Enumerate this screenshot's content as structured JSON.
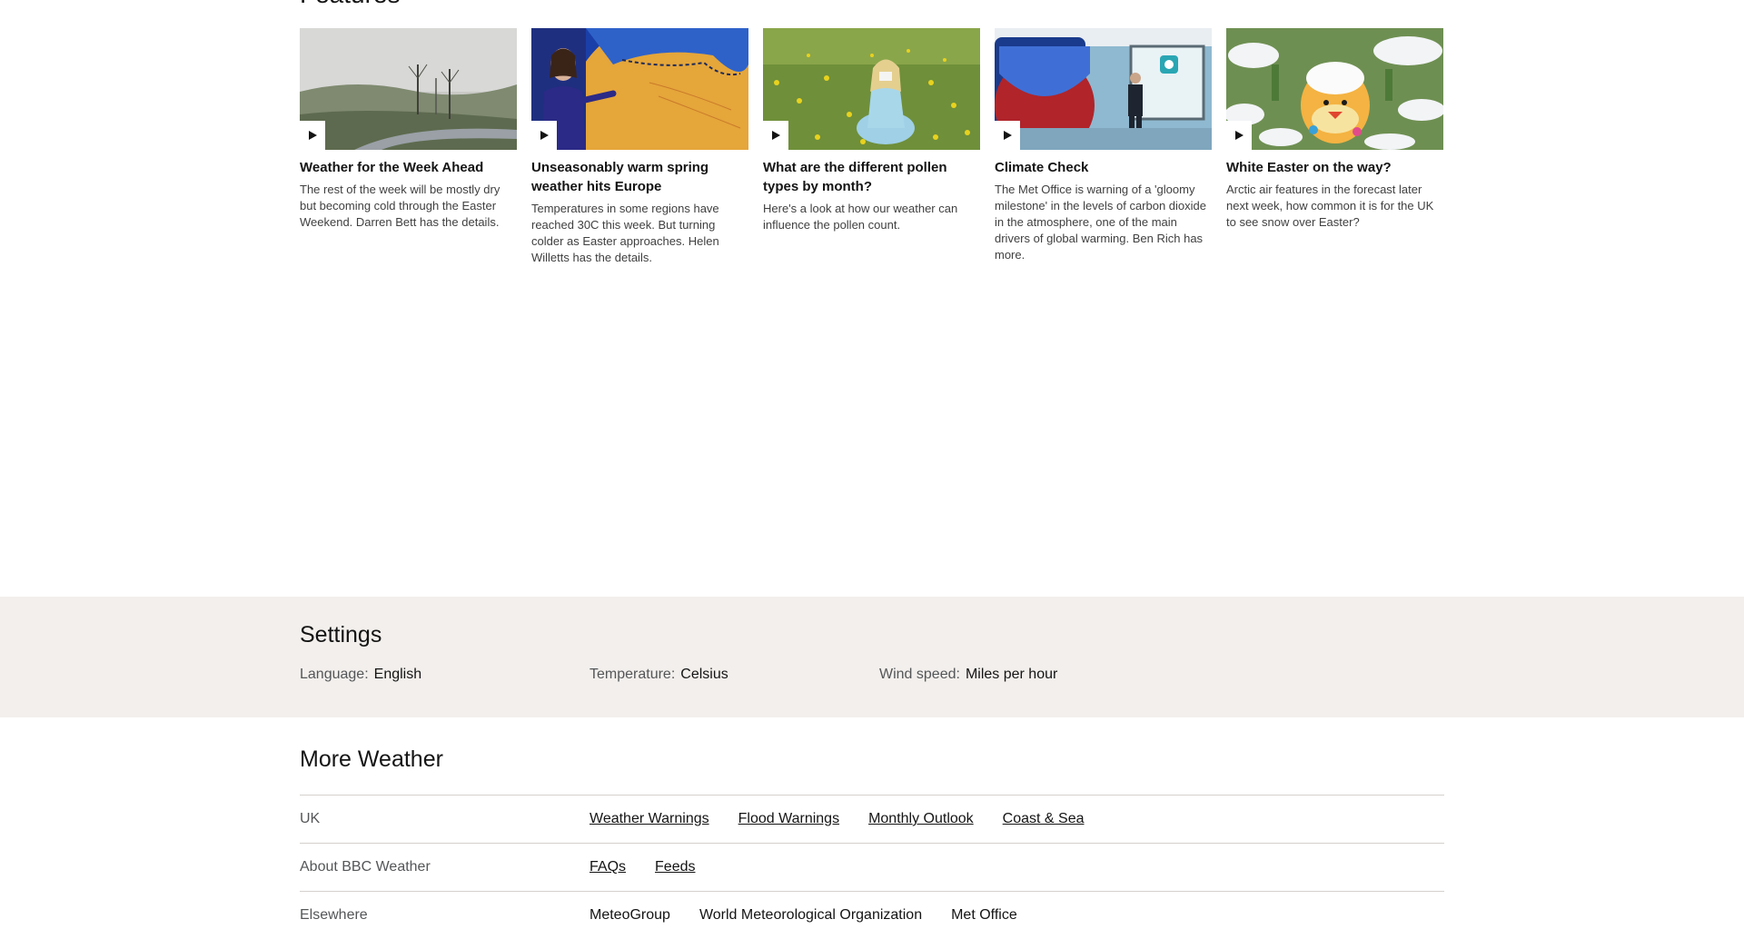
{
  "features": {
    "title": "Features",
    "cards": [
      {
        "title": "Weather for the Week Ahead",
        "desc": "The rest of the week will be mostly dry but becoming cold through the Easter Weekend. Darren Bett has the details."
      },
      {
        "title": "Unseasonably warm spring weather hits Europe",
        "desc": "Temperatures in some regions have reached 30C this week. But turning colder as Easter approaches. Helen Willetts has the details."
      },
      {
        "title": "What are the different pollen types by month?",
        "desc": "Here's a look at how our weather can influence the pollen count."
      },
      {
        "title": "Climate Check",
        "desc": "The Met Office is warning of a 'gloomy milestone' in the levels of carbon dioxide in the atmosphere, one of the main drivers of global warming. Ben Rich has more."
      },
      {
        "title": "White Easter on the way?",
        "desc": "Arctic air features in the forecast later next week, how common it is for the UK to see snow over Easter?"
      }
    ]
  },
  "settings": {
    "title": "Settings",
    "language": {
      "label": "Language:",
      "value": "English"
    },
    "temperature": {
      "label": "Temperature:",
      "value": "Celsius"
    },
    "wind": {
      "label": "Wind speed:",
      "value": "Miles per hour"
    }
  },
  "more_weather": {
    "title": "More Weather",
    "rows": [
      {
        "label": "UK",
        "links": [
          "Weather Warnings",
          "Flood Warnings",
          "Monthly Outlook",
          "Coast & Sea"
        ]
      },
      {
        "label": "About BBC Weather",
        "links": [
          "FAQs",
          "Feeds"
        ]
      },
      {
        "label": "Elsewhere",
        "links": [
          "MeteoGroup",
          "World Meteorological Organization",
          "Met Office"
        ]
      }
    ]
  },
  "icons": {
    "play": "play-icon"
  },
  "colors": {
    "settings_bg": "#f2efec",
    "divider": "#d5d0cd"
  }
}
